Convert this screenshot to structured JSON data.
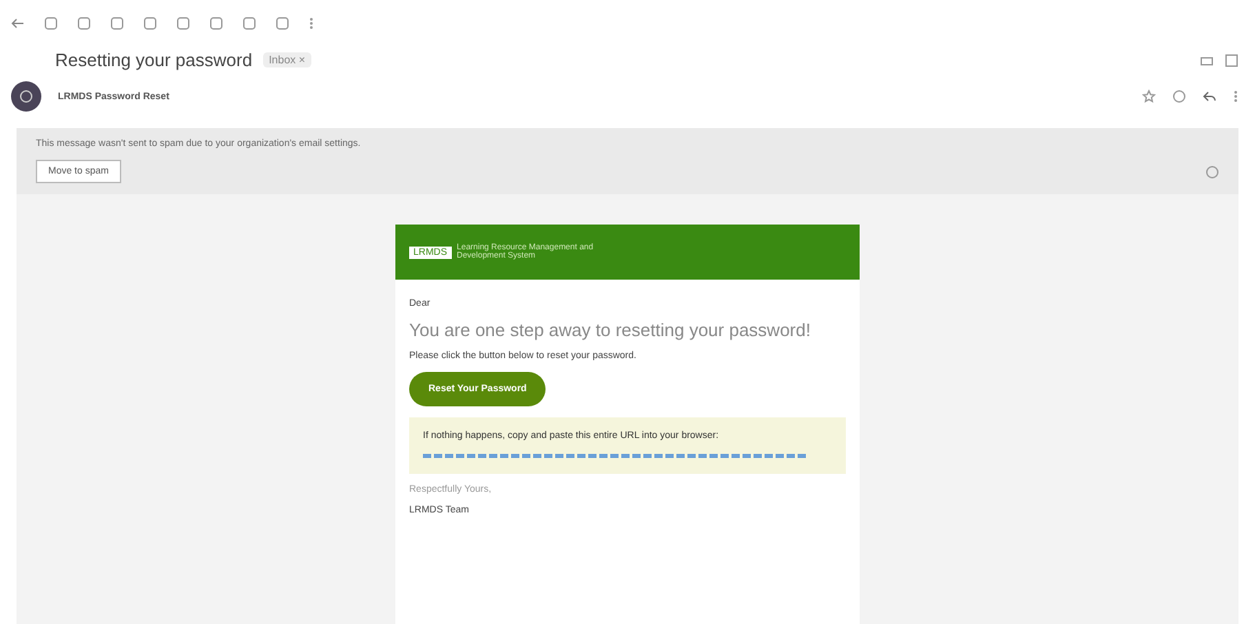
{
  "subject": "Resetting your password",
  "label_chip": "Inbox ×",
  "sender": {
    "name": "LRMDS Password Reset"
  },
  "banner": {
    "text": "This message wasn't sent to spam due to your organization's email settings.",
    "button": "Move to spam"
  },
  "email": {
    "logo": "LRMDS",
    "logo_caption": "Learning Resource Management and Development System",
    "greeting": "Dear",
    "heading": "You are one step away to resetting your password!",
    "instruction": "Please click the button below to reset your password.",
    "button": "Reset Your Password",
    "notice": "If nothing happens, copy and paste this entire URL into your browser:",
    "closing": "Respectfully Yours,",
    "signature": "LRMDS Team"
  }
}
